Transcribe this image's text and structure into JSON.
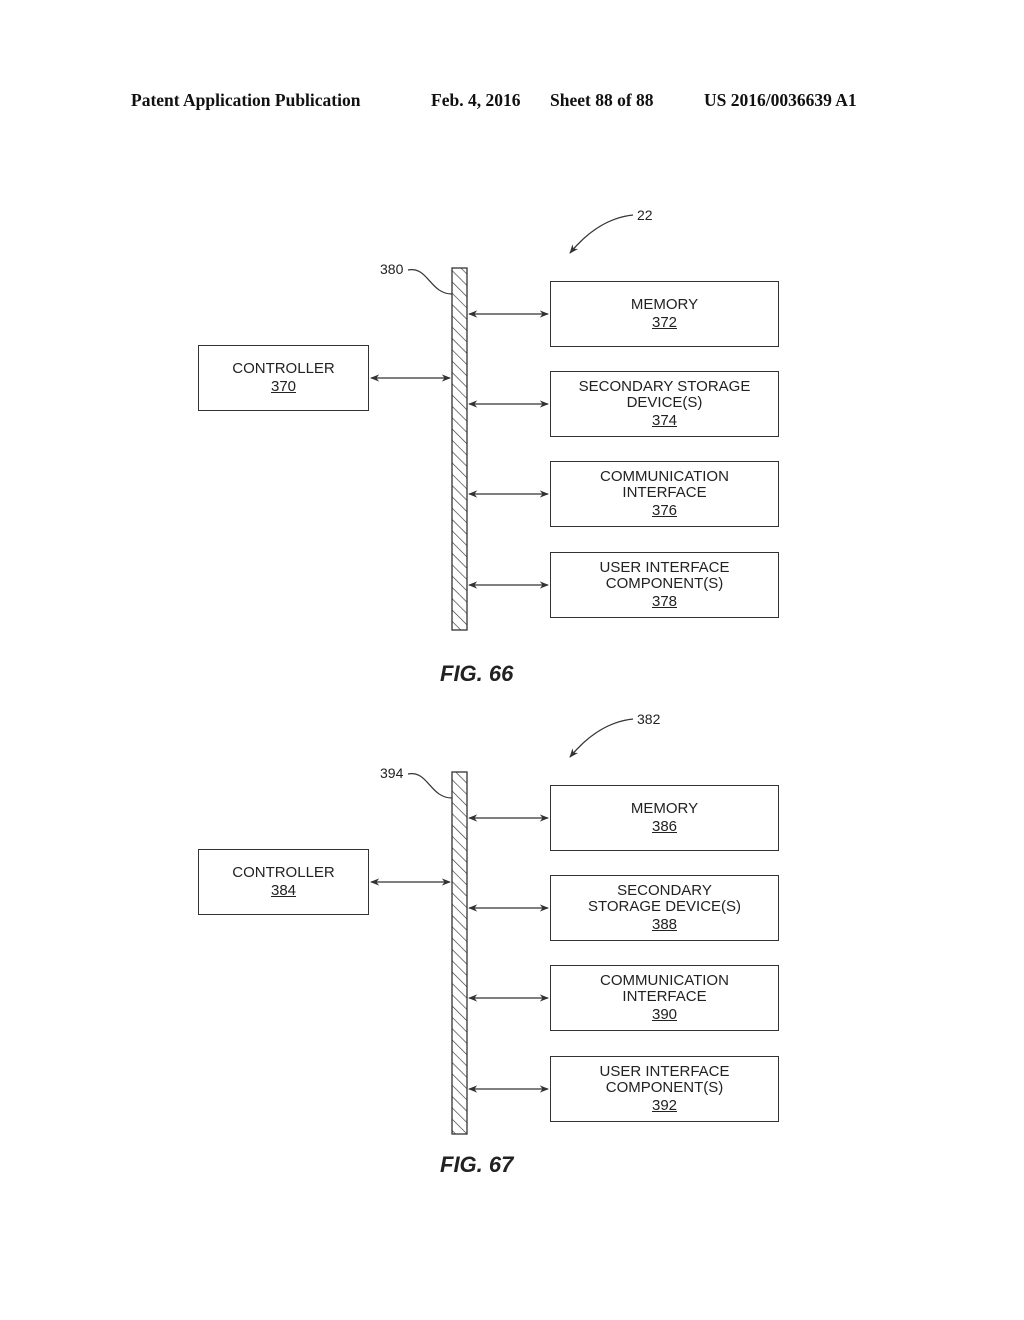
{
  "header": {
    "publication": "Patent Application Publication",
    "date": "Feb. 4, 2016",
    "sheet": "Sheet 88 of 88",
    "number": "US 2016/0036639 A1"
  },
  "figures": [
    {
      "label": "FIG. 66",
      "system_ref": "22",
      "bus_ref": "380",
      "controller": {
        "title": "CONTROLLER",
        "ref": "370"
      },
      "components": [
        {
          "lines": [
            "MEMORY"
          ],
          "ref": "372"
        },
        {
          "lines": [
            "SECONDARY STORAGE",
            "DEVICE(S)"
          ],
          "ref": "374"
        },
        {
          "lines": [
            "COMMUNICATION",
            "INTERFACE"
          ],
          "ref": "376"
        },
        {
          "lines": [
            "USER INTERFACE",
            "COMPONENT(S)"
          ],
          "ref": "378"
        }
      ]
    },
    {
      "label": "FIG. 67",
      "system_ref": "382",
      "bus_ref": "394",
      "controller": {
        "title": "CONTROLLER",
        "ref": "384"
      },
      "components": [
        {
          "lines": [
            "MEMORY"
          ],
          "ref": "386"
        },
        {
          "lines": [
            "SECONDARY",
            "STORAGE DEVICE(S)"
          ],
          "ref": "388"
        },
        {
          "lines": [
            "COMMUNICATION",
            "INTERFACE"
          ],
          "ref": "390"
        },
        {
          "lines": [
            "USER INTERFACE",
            "COMPONENT(S)"
          ],
          "ref": "392"
        }
      ]
    }
  ]
}
